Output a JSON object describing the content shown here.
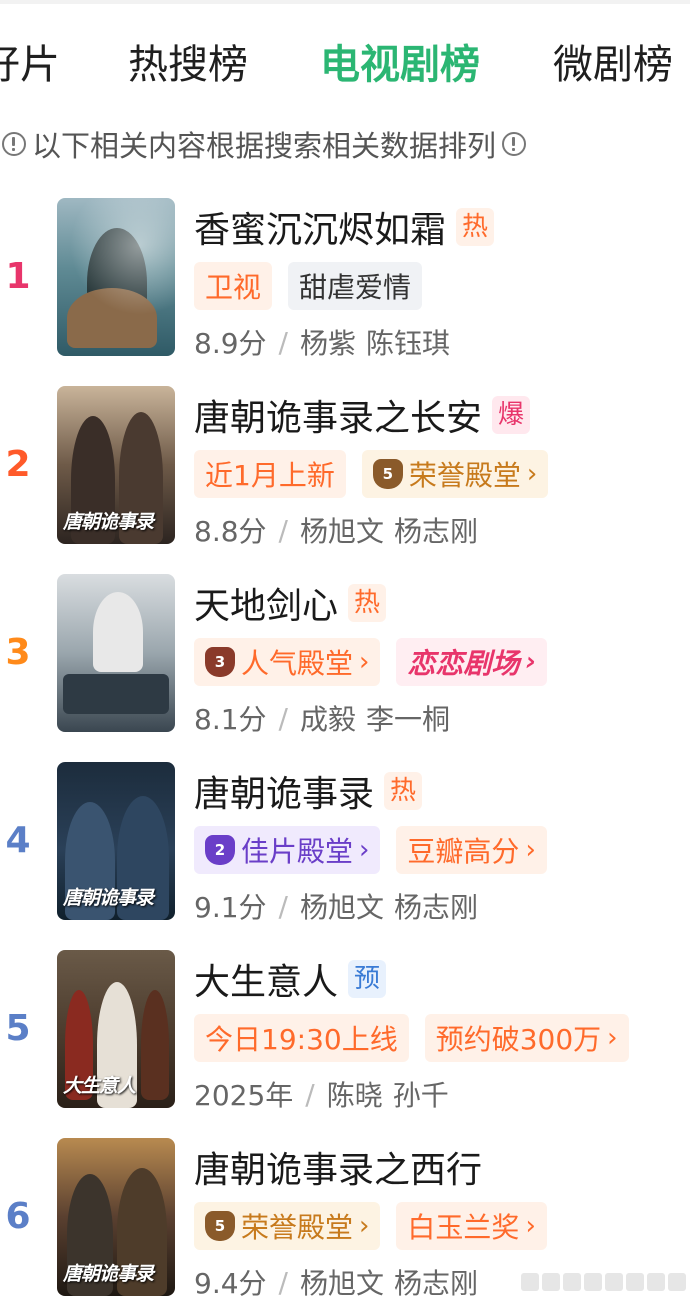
{
  "tabs": [
    {
      "label": "好片",
      "active": false
    },
    {
      "label": "热搜榜",
      "active": false
    },
    {
      "label": "电视剧榜",
      "active": true
    },
    {
      "label": "微剧榜",
      "active": false
    }
  ],
  "notice": {
    "text": "以下相关内容根据搜索相关数据排列",
    "icon": "info-circle-icon"
  },
  "colors": {
    "accent": "#2bb673",
    "rank_red": "#e8356b",
    "rank_orange": "#ff6a2b",
    "rank_blue": "#5b7fc7"
  },
  "items": [
    {
      "rank": "1",
      "title": "香蜜沉沉烬如霜",
      "badge": "热",
      "tags": [
        "卫视",
        "甜虐爱情"
      ],
      "score": "8.9分",
      "actors": [
        "杨紫",
        "陈钰琪"
      ]
    },
    {
      "rank": "2",
      "title": "唐朝诡事录之长安",
      "badge": "爆",
      "tags": [
        "近1月上新",
        "荣誉殿堂"
      ],
      "score": "8.8分",
      "actors": [
        "杨旭文",
        "杨志刚"
      ]
    },
    {
      "rank": "3",
      "title": "天地剑心",
      "badge": "热",
      "tags": [
        "人气殿堂",
        "恋恋剧场"
      ],
      "score": "8.1分",
      "actors": [
        "成毅",
        "李一桐"
      ]
    },
    {
      "rank": "4",
      "title": "唐朝诡事录",
      "badge": "热",
      "tags": [
        "佳片殿堂",
        "豆瓣高分"
      ],
      "score": "9.1分",
      "actors": [
        "杨旭文",
        "杨志刚"
      ]
    },
    {
      "rank": "5",
      "title": "大生意人",
      "badge": "预",
      "tags": [
        "今日19:30上线",
        "预约破300万"
      ],
      "score": "2025年",
      "actors": [
        "陈晓",
        "孙千"
      ]
    },
    {
      "rank": "6",
      "title": "唐朝诡事录之西行",
      "badge": "",
      "tags": [
        "荣誉殿堂",
        "白玉兰奖"
      ],
      "score": "9.4分",
      "actors": [
        "杨旭文",
        "杨志刚"
      ]
    }
  ]
}
